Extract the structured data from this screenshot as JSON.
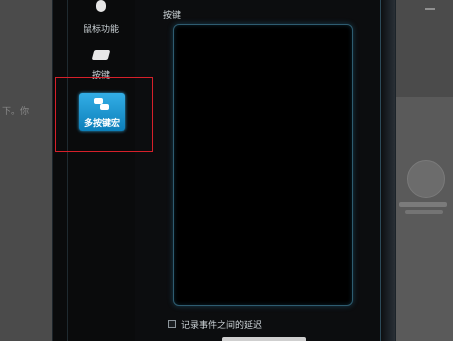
{
  "background": {
    "left_text": "下。你"
  },
  "sidebar": {
    "items": [
      {
        "label": "鼠标功能",
        "icon": "mouse-icon"
      },
      {
        "label": "按键",
        "icon": "key-icon"
      },
      {
        "label": "多按键宏",
        "icon": "multi-key-icon",
        "selected": true
      }
    ]
  },
  "main": {
    "section_title": "按键",
    "record_delay_label": "记录事件之间的延迟",
    "record_delay_checked": false
  },
  "colors": {
    "accent": "#1b94d1",
    "highlight": "#d6202a",
    "panel_border": "#2e5c70"
  }
}
